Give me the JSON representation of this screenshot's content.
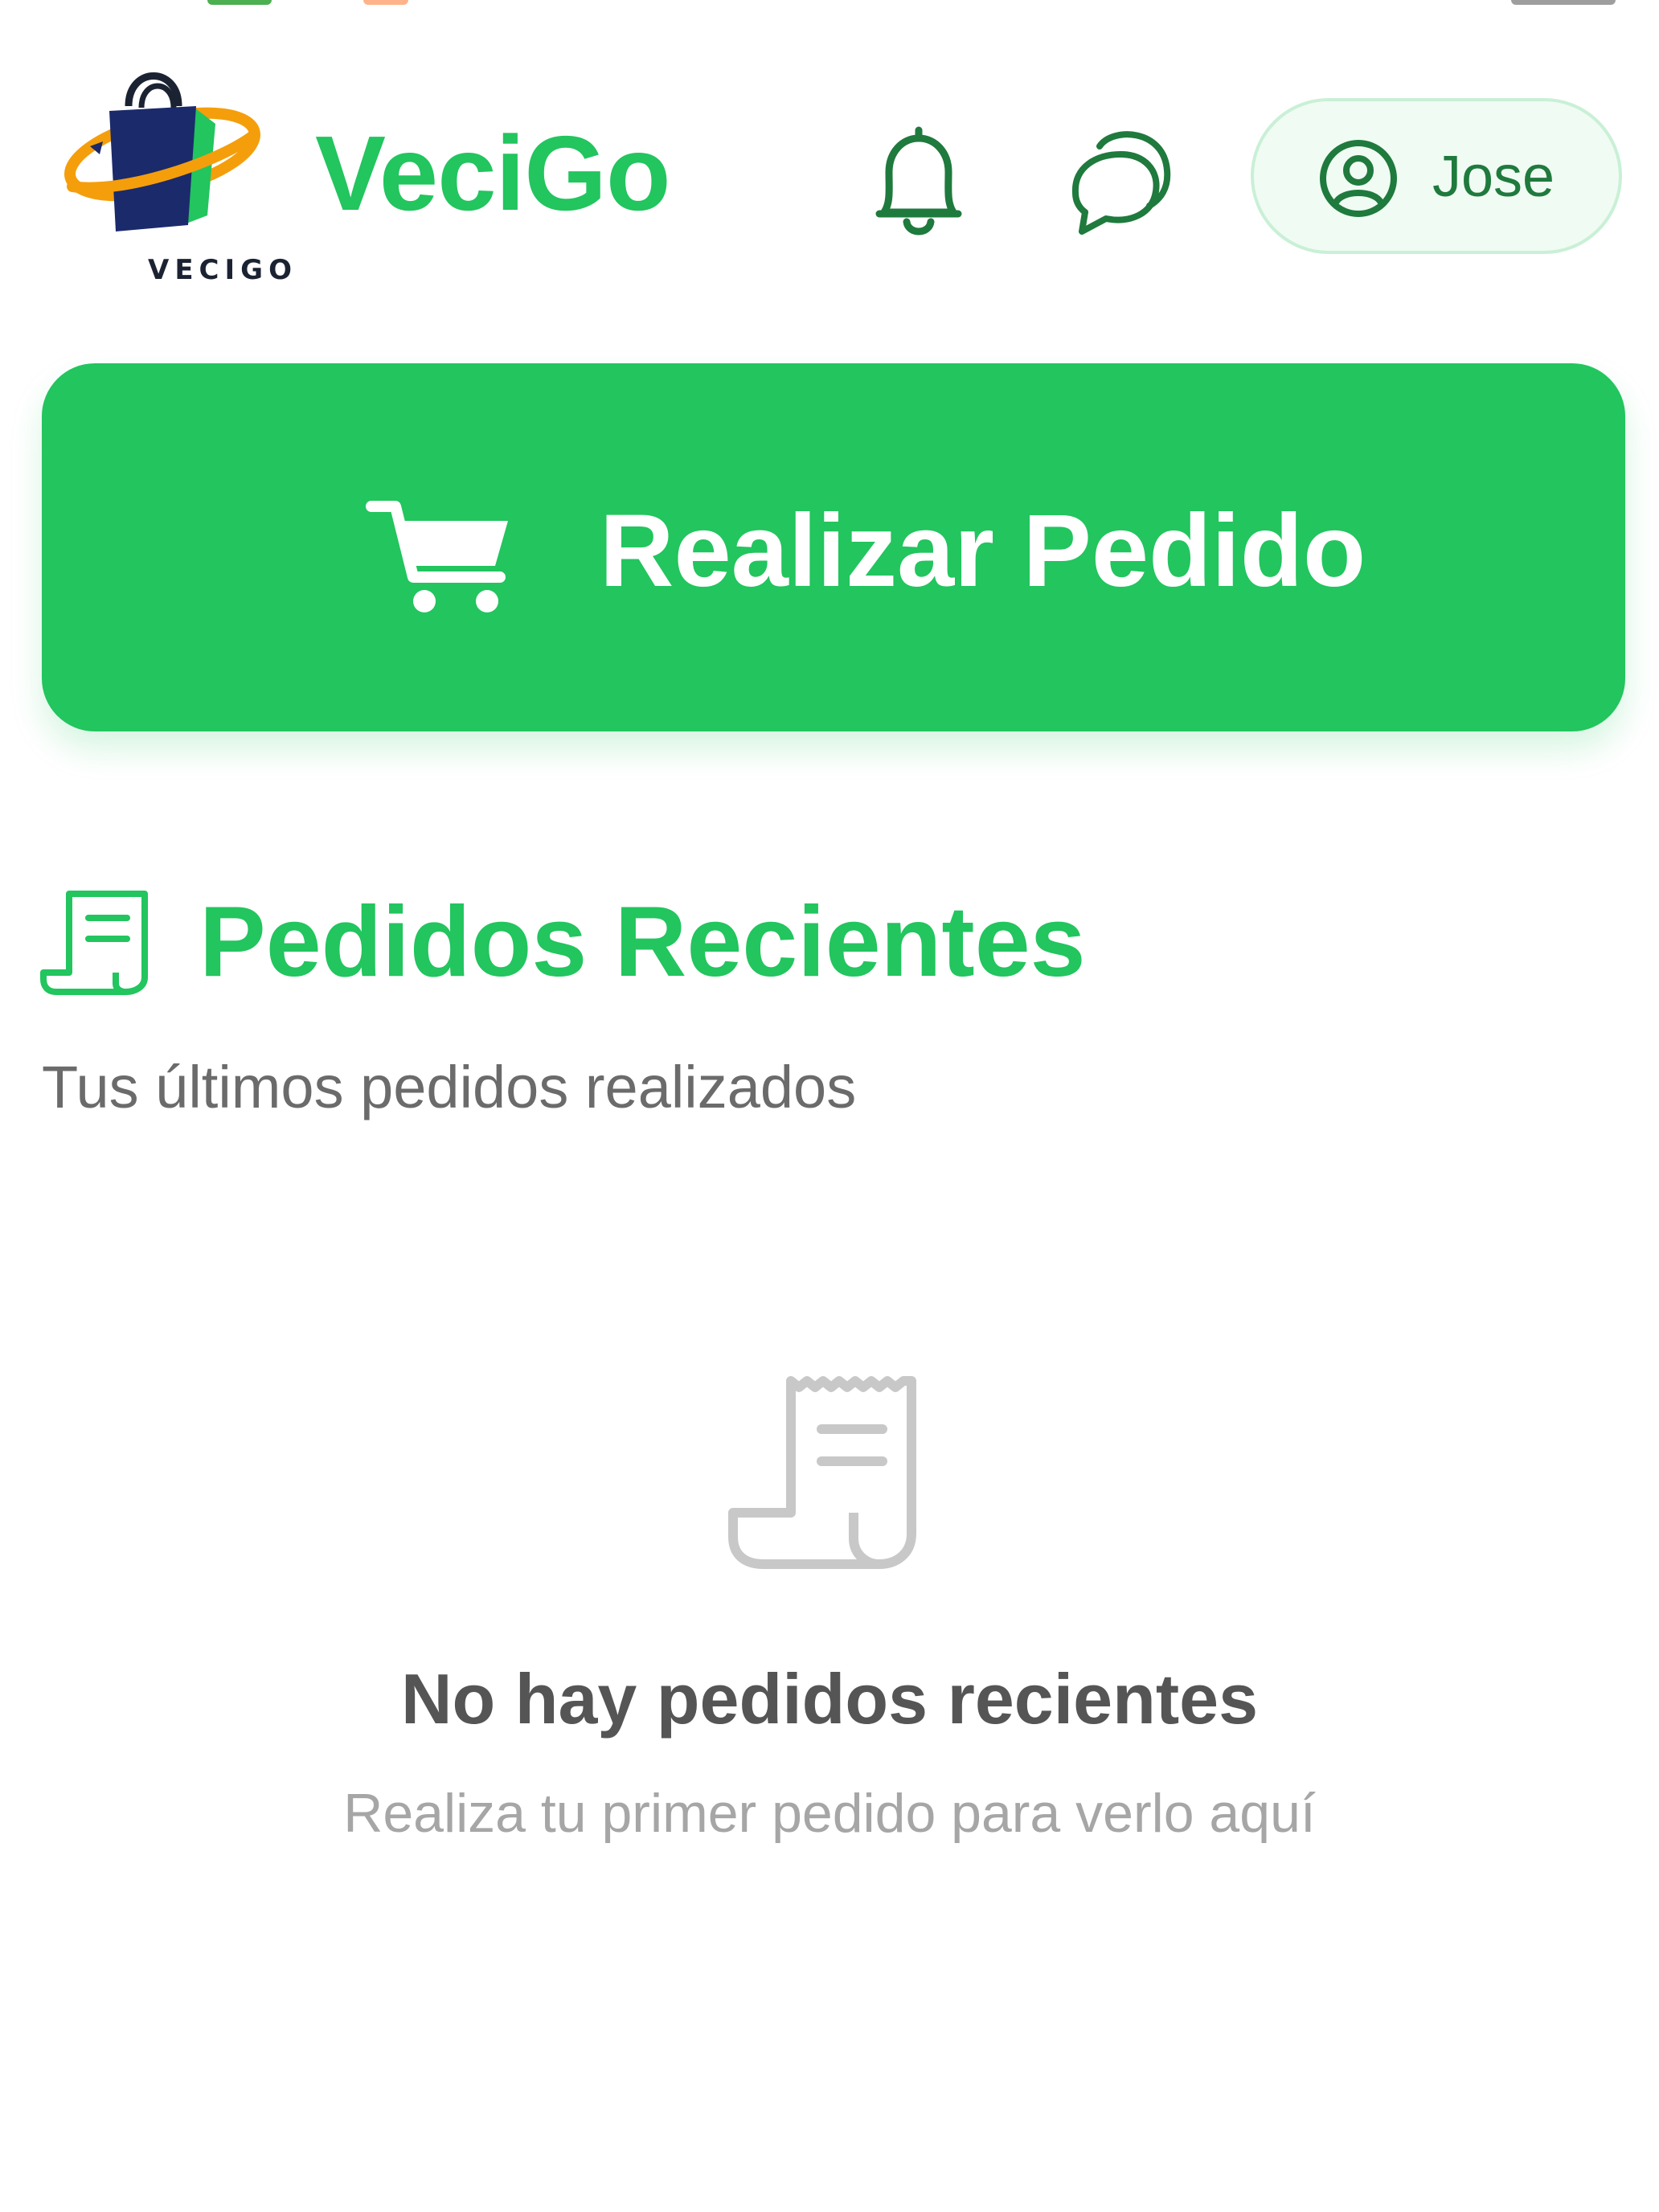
{
  "app": {
    "logo_text": "VECIGO",
    "brand_name": "VeciGo"
  },
  "header": {
    "icons": [
      "bell-icon",
      "chat-icon"
    ],
    "user_name": "Jose"
  },
  "actions": {
    "order_button_label": "Realizar Pedido",
    "order_button_icon": "cart-icon"
  },
  "recent_orders": {
    "title": "Pedidos Recientes",
    "subtitle": "Tus últimos pedidos realizados",
    "empty_title": "No hay pedidos recientes",
    "empty_subtitle": "Realiza tu primer pedido para verlo aquí"
  },
  "colors": {
    "brand_green": "#22c55e",
    "dark_green": "#1f7a3d",
    "logo_navy": "#1b2a6b",
    "logo_orange": "#f59e0b"
  }
}
